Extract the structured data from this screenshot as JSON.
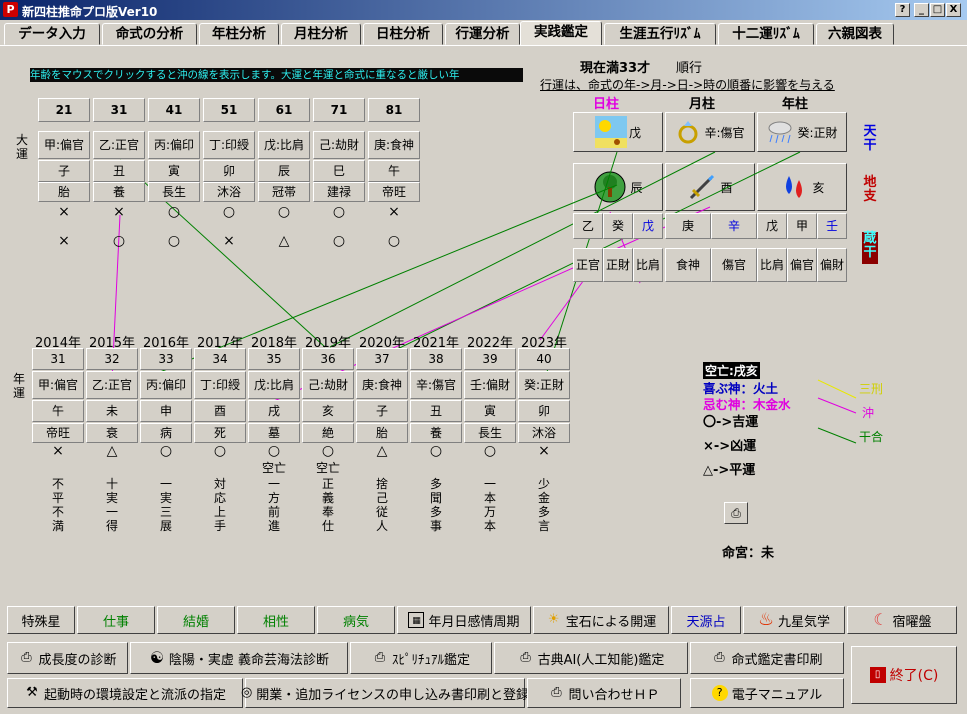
{
  "window": {
    "title": "新四柱推命プロ版Ver10",
    "controls": [
      "?",
      "_",
      "□",
      "X"
    ]
  },
  "tabs": [
    "データ入力",
    "命式の分析",
    "年柱分析",
    "月柱分析",
    "日柱分析",
    "行運分析",
    "実践鑑定",
    "生涯五行ﾘｽﾞﾑ",
    "十二運ﾘｽﾞﾑ",
    "六親図表"
  ],
  "active_tab": 6,
  "ticker": "年齢をマウスでクリックすると沖の線を表示します。大運と年運と命式に重なると厳しい年",
  "status": {
    "current_age": "現在満33才",
    "direction": "順行",
    "note": "行運は、命式の年->月->日->時の順番に影響を与える"
  },
  "daiun": {
    "label": "大運",
    "ages": [
      "21",
      "31",
      "41",
      "51",
      "61",
      "71",
      "81"
    ],
    "stems": [
      "甲:偏官",
      "乙:正官",
      "丙:偏印",
      "丁:印綬",
      "戊:比肩",
      "己:劫財",
      "庚:食神"
    ],
    "branches": [
      "子",
      "丑",
      "寅",
      "卯",
      "辰",
      "巳",
      "午"
    ],
    "stages": [
      "胎",
      "養",
      "長生",
      "沐浴",
      "冠帯",
      "建禄",
      "帝旺"
    ],
    "marks1": [
      "×",
      "×",
      "○",
      "○",
      "○",
      "○",
      "×"
    ],
    "marks2": [
      "×",
      "○",
      "○",
      "×",
      "△",
      "○",
      "○"
    ]
  },
  "nenun": {
    "label": "年運",
    "years": [
      "2014年",
      "2015年",
      "2016年",
      "2017年",
      "2018年",
      "2019年",
      "2020年",
      "2021年",
      "2022年",
      "2023年"
    ],
    "ages": [
      "31",
      "32",
      "33",
      "34",
      "35",
      "36",
      "37",
      "38",
      "39",
      "40"
    ],
    "stems": [
      "甲:偏官",
      "乙:正官",
      "丙:偏印",
      "丁:印綬",
      "戊:比肩",
      "己:劫財",
      "庚:食神",
      "辛:傷官",
      "壬:偏財",
      "癸:正財"
    ],
    "branches": [
      "午",
      "未",
      "申",
      "酉",
      "戌",
      "亥",
      "子",
      "丑",
      "寅",
      "卯"
    ],
    "stages": [
      "帝旺",
      "衰",
      "病",
      "死",
      "墓",
      "絶",
      "胎",
      "養",
      "長生",
      "沐浴"
    ],
    "marks": [
      "×",
      "△",
      "○",
      "○",
      "○",
      "○",
      "△",
      "○",
      "○",
      "×"
    ],
    "kubo": [
      "",
      "",
      "",
      "",
      "空亡",
      "空亡",
      "",
      "",
      "",
      ""
    ],
    "idioms": [
      "不平不満",
      "十実一得",
      "一実三展",
      "対応上手",
      "一方前進",
      "正義奉仕",
      "捨己従人",
      "多聞多事",
      "一本万本",
      "少金多言"
    ]
  },
  "pillars": {
    "headers": [
      "日柱",
      "月柱",
      "年柱"
    ],
    "stems": [
      "戊",
      "辛:傷官",
      "癸:正財"
    ],
    "branches": [
      "辰",
      "酉",
      "亥"
    ],
    "zokan": [
      [
        "乙",
        "癸",
        "戊"
      ],
      [
        "庚",
        "辛"
      ],
      [
        "戊",
        "甲",
        "壬"
      ]
    ],
    "zokan_tsuhen": [
      [
        "正官",
        "正財",
        "比肩"
      ],
      [
        "食神",
        "傷官"
      ],
      [
        "比肩",
        "偏官",
        "偏財"
      ]
    ],
    "side_labels": [
      "天干",
      "地支",
      "蔵干"
    ]
  },
  "legend": {
    "kubo": "空亡:戌亥",
    "yorokobu": "喜ぶ神：火土",
    "imu": "忌む神：木金水",
    "lines": [
      "三刑",
      "沖",
      "干合"
    ],
    "kichi": "〇->吉運",
    "kyo": "×->凶運",
    "hei": "△->平運",
    "meikyu": "命宮：未"
  },
  "buttons_row1": [
    "特殊星",
    "仕事",
    "結婚",
    "相性",
    "病気",
    "年月日感情周期",
    "宝石による開運",
    "天源占",
    "九星気学",
    "宿曜盤"
  ],
  "buttons_row2": [
    "成長度の診断",
    "陰陽・実虚 義命芸海法診断",
    "ｽﾋﾟﾘﾁｭｱﾙ鑑定",
    "古典AI(人工知能)鑑定",
    "命式鑑定書印刷"
  ],
  "buttons_row3": [
    "起動時の環境設定と流派の指定",
    "開業・追加ライセンスの申し込み書印刷と登録",
    "問い合わせＨＰ",
    "電子マニュアル"
  ],
  "exit": "終了(C)",
  "colors": {
    "title_start": "#0a246a",
    "ticker_bg": "#0a0a0a",
    "ticker_fg": "#2ef0f0",
    "magenta": "#e000e0",
    "green_line": "#008000",
    "yellow_line": "#e8e800"
  }
}
